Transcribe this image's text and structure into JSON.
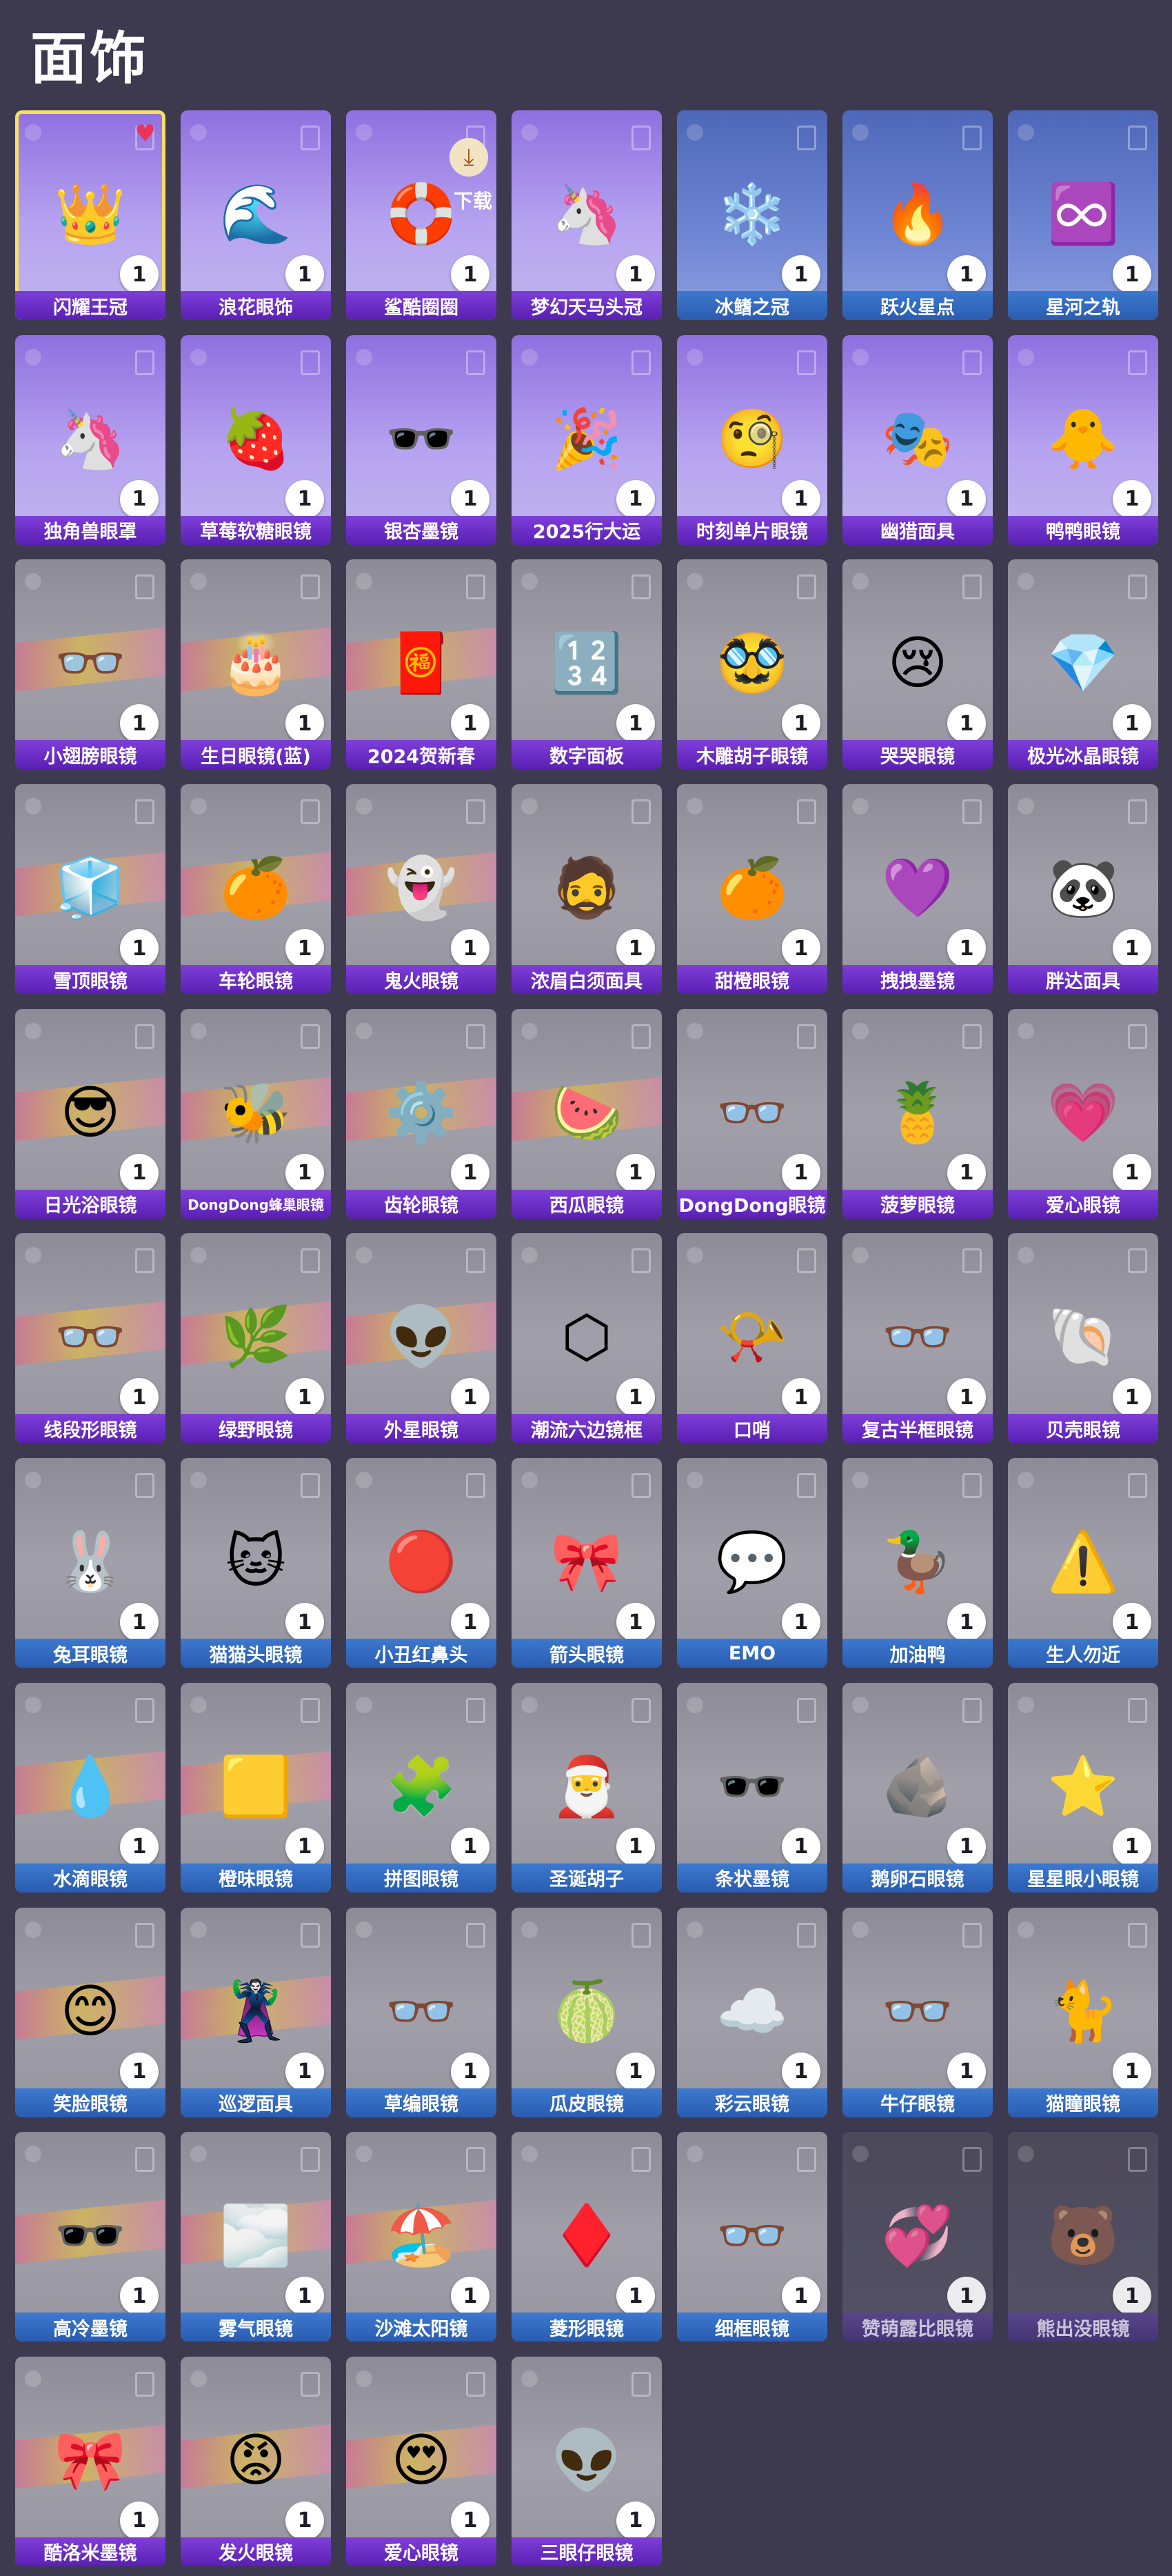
{
  "page_title": "面饰",
  "colors": {
    "background": "#3d3a4f",
    "label_purple": "#6a2fc6",
    "label_blue": "#3468bd",
    "selected_border": "#f4df6a",
    "favorite_heart": "#e8345b"
  },
  "download_label": "下载",
  "items": [
    {
      "name": "闪耀王冠",
      "count": "1",
      "icon": "👑",
      "style": "purple",
      "selected": true,
      "favorite": true
    },
    {
      "name": "浪花眼饰",
      "count": "1",
      "icon": "🌊",
      "style": "purple"
    },
    {
      "name": "鲨酷圈圈",
      "count": "1",
      "icon": "🛟",
      "style": "purple",
      "downloading": true
    },
    {
      "name": "梦幻天马头冠",
      "count": "1",
      "icon": "🦄",
      "style": "purple"
    },
    {
      "name": "冰鳍之冠",
      "count": "1",
      "icon": "❄️",
      "style": "blue",
      "bluelabel": true
    },
    {
      "name": "跃火星点",
      "count": "1",
      "icon": "🔥",
      "style": "blue",
      "bluelabel": true
    },
    {
      "name": "星河之轨",
      "count": "1",
      "icon": "♾️",
      "style": "blue",
      "bluelabel": true
    },
    {
      "name": "独角兽眼罩",
      "count": "1",
      "icon": "🦄",
      "style": "purple"
    },
    {
      "name": "草莓软糖眼镜",
      "count": "1",
      "icon": "🍓",
      "style": "purple"
    },
    {
      "name": "银杏墨镜",
      "count": "1",
      "icon": "🕶️",
      "style": "purple"
    },
    {
      "name": "2025行大运",
      "count": "1",
      "icon": "🎉",
      "style": "purple"
    },
    {
      "name": "时刻单片眼镜",
      "count": "1",
      "icon": "🧐",
      "style": "purple"
    },
    {
      "name": "幽猎面具",
      "count": "1",
      "icon": "🎭",
      "style": "purple"
    },
    {
      "name": "鸭鸭眼镜",
      "count": "1",
      "icon": "🐥",
      "style": "purple"
    },
    {
      "name": "小翅膀眼镜",
      "count": "1",
      "icon": "👓",
      "style": "grey",
      "stripe": true
    },
    {
      "name": "生日眼镜(蓝)",
      "count": "1",
      "icon": "🎂",
      "style": "grey",
      "stripe": true
    },
    {
      "name": "2024贺新春",
      "count": "1",
      "icon": "🧧",
      "style": "grey",
      "stripe": true
    },
    {
      "name": "数字面板",
      "count": "1",
      "icon": "🔢",
      "style": "grey"
    },
    {
      "name": "木雕胡子眼镜",
      "count": "1",
      "icon": "🥸",
      "style": "grey"
    },
    {
      "name": "哭哭眼镜",
      "count": "1",
      "icon": "😢",
      "style": "grey"
    },
    {
      "name": "极光冰晶眼镜",
      "count": "1",
      "icon": "💎",
      "style": "grey"
    },
    {
      "name": "雪顶眼镜",
      "count": "1",
      "icon": "🧊",
      "style": "grey",
      "stripe": true
    },
    {
      "name": "车轮眼镜",
      "count": "1",
      "icon": "🍊",
      "style": "grey",
      "stripe": true
    },
    {
      "name": "鬼火眼镜",
      "count": "1",
      "icon": "👻",
      "style": "grey",
      "stripe": true
    },
    {
      "name": "浓眉白须面具",
      "count": "1",
      "icon": "🧔",
      "style": "grey"
    },
    {
      "name": "甜橙眼镜",
      "count": "1",
      "icon": "🍊",
      "style": "grey"
    },
    {
      "name": "拽拽墨镜",
      "count": "1",
      "icon": "💜",
      "style": "grey"
    },
    {
      "name": "胖达面具",
      "count": "1",
      "icon": "🐼",
      "style": "grey"
    },
    {
      "name": "日光浴眼镜",
      "count": "1",
      "icon": "😎",
      "style": "grey",
      "stripe": true
    },
    {
      "name": "DongDong蜂巢眼镜",
      "count": "1",
      "icon": "🐝",
      "style": "grey",
      "stripe": true,
      "small": true
    },
    {
      "name": "齿轮眼镜",
      "count": "1",
      "icon": "⚙️",
      "style": "grey",
      "stripe": true
    },
    {
      "name": "西瓜眼镜",
      "count": "1",
      "icon": "🍉",
      "style": "grey",
      "stripe": true
    },
    {
      "name": "DongDong眼镜",
      "count": "1",
      "icon": "👓",
      "style": "grey"
    },
    {
      "name": "菠萝眼镜",
      "count": "1",
      "icon": "🍍",
      "style": "grey"
    },
    {
      "name": "爱心眼镜",
      "count": "1",
      "icon": "💗",
      "style": "grey"
    },
    {
      "name": "线段形眼镜",
      "count": "1",
      "icon": "👓",
      "style": "grey",
      "stripe": true
    },
    {
      "name": "绿野眼镜",
      "count": "1",
      "icon": "🌿",
      "style": "grey",
      "stripe": true
    },
    {
      "name": "外星眼镜",
      "count": "1",
      "icon": "👽",
      "style": "grey",
      "stripe": true
    },
    {
      "name": "潮流六边镜框",
      "count": "1",
      "icon": "⬡",
      "style": "grey"
    },
    {
      "name": "口哨",
      "count": "1",
      "icon": "📯",
      "style": "grey"
    },
    {
      "name": "复古半框眼镜",
      "count": "1",
      "icon": "👓",
      "style": "grey"
    },
    {
      "name": "贝壳眼镜",
      "count": "1",
      "icon": "🐚",
      "style": "grey"
    },
    {
      "name": "兔耳眼镜",
      "count": "1",
      "icon": "🐰",
      "style": "grey",
      "bluelabel": true
    },
    {
      "name": "猫猫头眼镜",
      "count": "1",
      "icon": "🐱",
      "style": "grey",
      "bluelabel": true
    },
    {
      "name": "小丑红鼻头",
      "count": "1",
      "icon": "🔴",
      "style": "grey",
      "bluelabel": true
    },
    {
      "name": "箭头眼镜",
      "count": "1",
      "icon": "🎀",
      "style": "grey",
      "bluelabel": true
    },
    {
      "name": "EMO",
      "count": "1",
      "icon": "💬",
      "style": "grey",
      "bluelabel": true
    },
    {
      "name": "加油鸭",
      "count": "1",
      "icon": "🦆",
      "style": "grey",
      "bluelabel": true
    },
    {
      "name": "生人勿近",
      "count": "1",
      "icon": "⚠️",
      "style": "grey",
      "bluelabel": true
    },
    {
      "name": "水滴眼镜",
      "count": "1",
      "icon": "💧",
      "style": "grey",
      "stripe": true,
      "bluelabel": true
    },
    {
      "name": "橙味眼镜",
      "count": "1",
      "icon": "🟨",
      "style": "grey",
      "stripe": true,
      "bluelabel": true
    },
    {
      "name": "拼图眼镜",
      "count": "1",
      "icon": "🧩",
      "style": "grey",
      "bluelabel": true
    },
    {
      "name": "圣诞胡子",
      "count": "1",
      "icon": "🎅",
      "style": "grey",
      "bluelabel": true
    },
    {
      "name": "条状墨镜",
      "count": "1",
      "icon": "🕶️",
      "style": "grey",
      "bluelabel": true
    },
    {
      "name": "鹅卵石眼镜",
      "count": "1",
      "icon": "🪨",
      "style": "grey",
      "bluelabel": true
    },
    {
      "name": "星星眼小眼镜",
      "count": "1",
      "icon": "⭐",
      "style": "grey",
      "bluelabel": true
    },
    {
      "name": "笑脸眼镜",
      "count": "1",
      "icon": "😊",
      "style": "grey",
      "stripe": true,
      "bluelabel": true
    },
    {
      "name": "巡逻面具",
      "count": "1",
      "icon": "🦹",
      "style": "grey",
      "stripe": true,
      "bluelabel": true
    },
    {
      "name": "草编眼镜",
      "count": "1",
      "icon": "👓",
      "style": "grey",
      "bluelabel": true
    },
    {
      "name": "瓜皮眼镜",
      "count": "1",
      "icon": "🍈",
      "style": "grey",
      "bluelabel": true
    },
    {
      "name": "彩云眼镜",
      "count": "1",
      "icon": "☁️",
      "style": "grey",
      "bluelabel": true
    },
    {
      "name": "牛仔眼镜",
      "count": "1",
      "icon": "👓",
      "style": "grey",
      "bluelabel": true
    },
    {
      "name": "猫瞳眼镜",
      "count": "1",
      "icon": "🐈",
      "style": "grey",
      "bluelabel": true
    },
    {
      "name": "高冷墨镜",
      "count": "1",
      "icon": "🕶️",
      "style": "grey",
      "stripe": true,
      "bluelabel": true
    },
    {
      "name": "雾气眼镜",
      "count": "1",
      "icon": "🌫️",
      "style": "grey",
      "stripe": true,
      "bluelabel": true
    },
    {
      "name": "沙滩太阳镜",
      "count": "1",
      "icon": "🏖️",
      "style": "grey",
      "stripe": true,
      "bluelabel": true
    },
    {
      "name": "菱形眼镜",
      "count": "1",
      "icon": "♦️",
      "style": "grey",
      "bluelabel": true
    },
    {
      "name": "细框眼镜",
      "count": "1",
      "icon": "👓",
      "style": "grey",
      "bluelabel": true
    },
    {
      "name": "赞萌露比眼镜",
      "count": "1",
      "icon": "💞",
      "style": "locked"
    },
    {
      "name": "熊出没眼镜",
      "count": "1",
      "icon": "🐻",
      "style": "locked"
    },
    {
      "name": "酷洛米墨镜",
      "count": "1",
      "icon": "🎀",
      "style": "grey",
      "stripe": true
    },
    {
      "name": "发火眼镜",
      "count": "1",
      "icon": "😡",
      "style": "grey",
      "stripe": true
    },
    {
      "name": "爱心眼镜",
      "count": "1",
      "icon": "😍",
      "style": "grey",
      "stripe": true
    },
    {
      "name": "三眼仔眼镜",
      "count": "1",
      "icon": "👽",
      "style": "grey"
    }
  ]
}
